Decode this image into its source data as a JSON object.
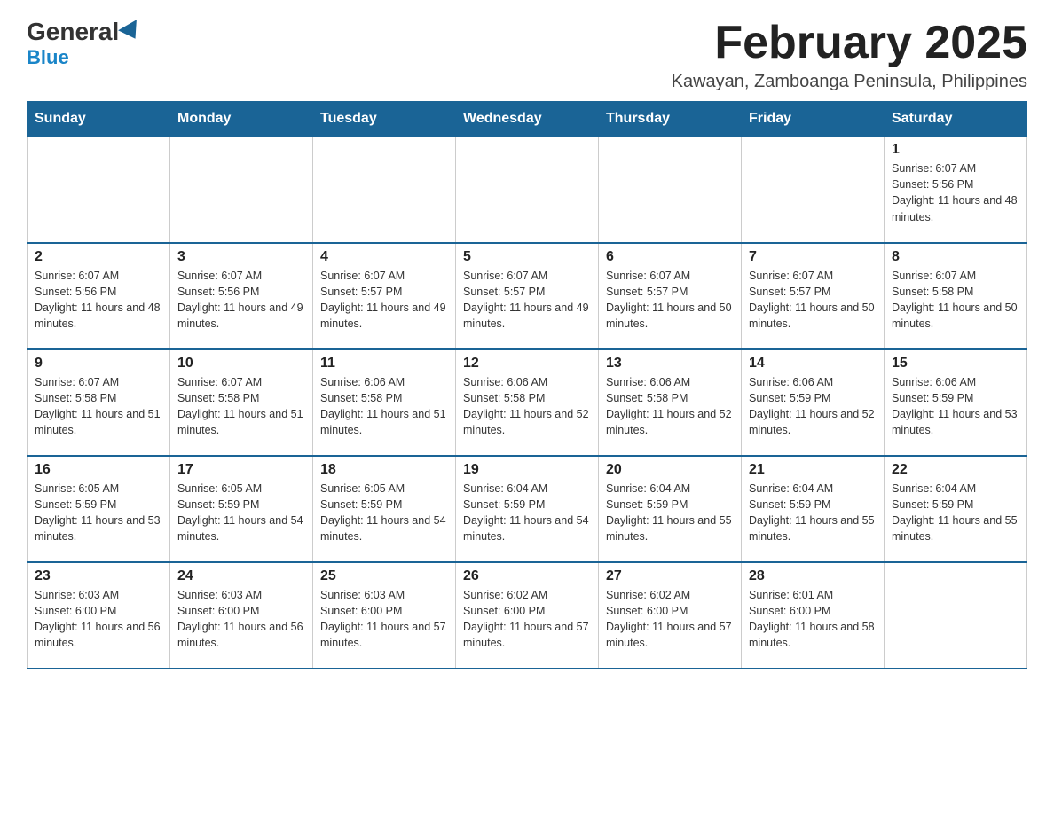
{
  "header": {
    "logo": {
      "general": "General",
      "blue": "Blue"
    },
    "title": "February 2025",
    "location": "Kawayan, Zamboanga Peninsula, Philippines"
  },
  "days_of_week": [
    "Sunday",
    "Monday",
    "Tuesday",
    "Wednesday",
    "Thursday",
    "Friday",
    "Saturday"
  ],
  "weeks": [
    [
      {
        "day": "",
        "sunrise": "",
        "sunset": "",
        "daylight": ""
      },
      {
        "day": "",
        "sunrise": "",
        "sunset": "",
        "daylight": ""
      },
      {
        "day": "",
        "sunrise": "",
        "sunset": "",
        "daylight": ""
      },
      {
        "day": "",
        "sunrise": "",
        "sunset": "",
        "daylight": ""
      },
      {
        "day": "",
        "sunrise": "",
        "sunset": "",
        "daylight": ""
      },
      {
        "day": "",
        "sunrise": "",
        "sunset": "",
        "daylight": ""
      },
      {
        "day": "1",
        "sunrise": "Sunrise: 6:07 AM",
        "sunset": "Sunset: 5:56 PM",
        "daylight": "Daylight: 11 hours and 48 minutes."
      }
    ],
    [
      {
        "day": "2",
        "sunrise": "Sunrise: 6:07 AM",
        "sunset": "Sunset: 5:56 PM",
        "daylight": "Daylight: 11 hours and 48 minutes."
      },
      {
        "day": "3",
        "sunrise": "Sunrise: 6:07 AM",
        "sunset": "Sunset: 5:56 PM",
        "daylight": "Daylight: 11 hours and 49 minutes."
      },
      {
        "day": "4",
        "sunrise": "Sunrise: 6:07 AM",
        "sunset": "Sunset: 5:57 PM",
        "daylight": "Daylight: 11 hours and 49 minutes."
      },
      {
        "day": "5",
        "sunrise": "Sunrise: 6:07 AM",
        "sunset": "Sunset: 5:57 PM",
        "daylight": "Daylight: 11 hours and 49 minutes."
      },
      {
        "day": "6",
        "sunrise": "Sunrise: 6:07 AM",
        "sunset": "Sunset: 5:57 PM",
        "daylight": "Daylight: 11 hours and 50 minutes."
      },
      {
        "day": "7",
        "sunrise": "Sunrise: 6:07 AM",
        "sunset": "Sunset: 5:57 PM",
        "daylight": "Daylight: 11 hours and 50 minutes."
      },
      {
        "day": "8",
        "sunrise": "Sunrise: 6:07 AM",
        "sunset": "Sunset: 5:58 PM",
        "daylight": "Daylight: 11 hours and 50 minutes."
      }
    ],
    [
      {
        "day": "9",
        "sunrise": "Sunrise: 6:07 AM",
        "sunset": "Sunset: 5:58 PM",
        "daylight": "Daylight: 11 hours and 51 minutes."
      },
      {
        "day": "10",
        "sunrise": "Sunrise: 6:07 AM",
        "sunset": "Sunset: 5:58 PM",
        "daylight": "Daylight: 11 hours and 51 minutes."
      },
      {
        "day": "11",
        "sunrise": "Sunrise: 6:06 AM",
        "sunset": "Sunset: 5:58 PM",
        "daylight": "Daylight: 11 hours and 51 minutes."
      },
      {
        "day": "12",
        "sunrise": "Sunrise: 6:06 AM",
        "sunset": "Sunset: 5:58 PM",
        "daylight": "Daylight: 11 hours and 52 minutes."
      },
      {
        "day": "13",
        "sunrise": "Sunrise: 6:06 AM",
        "sunset": "Sunset: 5:58 PM",
        "daylight": "Daylight: 11 hours and 52 minutes."
      },
      {
        "day": "14",
        "sunrise": "Sunrise: 6:06 AM",
        "sunset": "Sunset: 5:59 PM",
        "daylight": "Daylight: 11 hours and 52 minutes."
      },
      {
        "day": "15",
        "sunrise": "Sunrise: 6:06 AM",
        "sunset": "Sunset: 5:59 PM",
        "daylight": "Daylight: 11 hours and 53 minutes."
      }
    ],
    [
      {
        "day": "16",
        "sunrise": "Sunrise: 6:05 AM",
        "sunset": "Sunset: 5:59 PM",
        "daylight": "Daylight: 11 hours and 53 minutes."
      },
      {
        "day": "17",
        "sunrise": "Sunrise: 6:05 AM",
        "sunset": "Sunset: 5:59 PM",
        "daylight": "Daylight: 11 hours and 54 minutes."
      },
      {
        "day": "18",
        "sunrise": "Sunrise: 6:05 AM",
        "sunset": "Sunset: 5:59 PM",
        "daylight": "Daylight: 11 hours and 54 minutes."
      },
      {
        "day": "19",
        "sunrise": "Sunrise: 6:04 AM",
        "sunset": "Sunset: 5:59 PM",
        "daylight": "Daylight: 11 hours and 54 minutes."
      },
      {
        "day": "20",
        "sunrise": "Sunrise: 6:04 AM",
        "sunset": "Sunset: 5:59 PM",
        "daylight": "Daylight: 11 hours and 55 minutes."
      },
      {
        "day": "21",
        "sunrise": "Sunrise: 6:04 AM",
        "sunset": "Sunset: 5:59 PM",
        "daylight": "Daylight: 11 hours and 55 minutes."
      },
      {
        "day": "22",
        "sunrise": "Sunrise: 6:04 AM",
        "sunset": "Sunset: 5:59 PM",
        "daylight": "Daylight: 11 hours and 55 minutes."
      }
    ],
    [
      {
        "day": "23",
        "sunrise": "Sunrise: 6:03 AM",
        "sunset": "Sunset: 6:00 PM",
        "daylight": "Daylight: 11 hours and 56 minutes."
      },
      {
        "day": "24",
        "sunrise": "Sunrise: 6:03 AM",
        "sunset": "Sunset: 6:00 PM",
        "daylight": "Daylight: 11 hours and 56 minutes."
      },
      {
        "day": "25",
        "sunrise": "Sunrise: 6:03 AM",
        "sunset": "Sunset: 6:00 PM",
        "daylight": "Daylight: 11 hours and 57 minutes."
      },
      {
        "day": "26",
        "sunrise": "Sunrise: 6:02 AM",
        "sunset": "Sunset: 6:00 PM",
        "daylight": "Daylight: 11 hours and 57 minutes."
      },
      {
        "day": "27",
        "sunrise": "Sunrise: 6:02 AM",
        "sunset": "Sunset: 6:00 PM",
        "daylight": "Daylight: 11 hours and 57 minutes."
      },
      {
        "day": "28",
        "sunrise": "Sunrise: 6:01 AM",
        "sunset": "Sunset: 6:00 PM",
        "daylight": "Daylight: 11 hours and 58 minutes."
      },
      {
        "day": "",
        "sunrise": "",
        "sunset": "",
        "daylight": ""
      }
    ]
  ]
}
